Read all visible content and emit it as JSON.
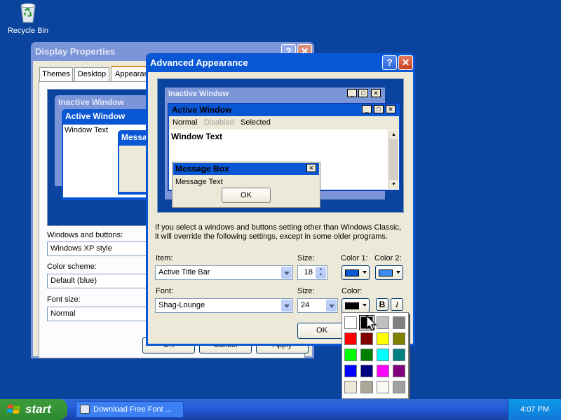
{
  "desktop": {
    "recycle_bin_label": "Recycle Bin"
  },
  "display_props": {
    "title": "Display Properties",
    "tabs": [
      "Themes",
      "Desktop",
      "Appearance"
    ],
    "preview": {
      "inactive_title": "Inactive Window",
      "active_title": "Active Window",
      "window_text": "Window Text",
      "message_title": "Message Box"
    },
    "windows_buttons_label": "Windows and buttons:",
    "windows_buttons_value": "Windows XP style",
    "color_scheme_label": "Color scheme:",
    "color_scheme_value": "Default (blue)",
    "font_size_label": "Font size:",
    "font_size_value": "Normal",
    "ok_label": "OK",
    "cancel_label": "Cancel",
    "apply_label": "Apply"
  },
  "advanced": {
    "title": "Advanced Appearance",
    "preview": {
      "inactive_title": "Inactive Window",
      "active_title": "Active Window",
      "menu_normal": "Normal",
      "menu_disabled": "Disabled",
      "menu_selected": "Selected",
      "window_text": "Window Text",
      "message_title": "Message Box",
      "message_text": "Message Text",
      "message_ok": "OK"
    },
    "info_line1": "If you select a windows and buttons setting other than Windows Classic,",
    "info_line2": "it will override the following settings, except in some older programs.",
    "item_label": "Item:",
    "item_value": "Active Title Bar",
    "size_label": "Size:",
    "size_value": "18",
    "color1_label": "Color 1:",
    "color2_label": "Color 2:",
    "font_label": "Font:",
    "font_value": "Shag-Lounge",
    "font_size_label": "Size:",
    "font_size_value": "24",
    "color_label": "Color:",
    "bold_label": "B",
    "italic_label": "I",
    "ok_label": "OK"
  },
  "colors": {
    "color1": "#0a57d6",
    "color2": "#3a8cf0",
    "font_color": "#000000",
    "palette": [
      "#ffffff",
      "#000000",
      "#c0c0c0",
      "#808080",
      "#ff0000",
      "#800000",
      "#ffff00",
      "#808000",
      "#00ff00",
      "#008000",
      "#00ffff",
      "#008080",
      "#0000ff",
      "#000080",
      "#ff00ff",
      "#800080",
      "#ece9d8",
      "#aca899",
      "#f9f8f3",
      "#a0a0a0"
    ]
  },
  "taskbar": {
    "start_label": "start",
    "task_item_label": "Download Free Font ...",
    "clock": "4:07 PM"
  }
}
